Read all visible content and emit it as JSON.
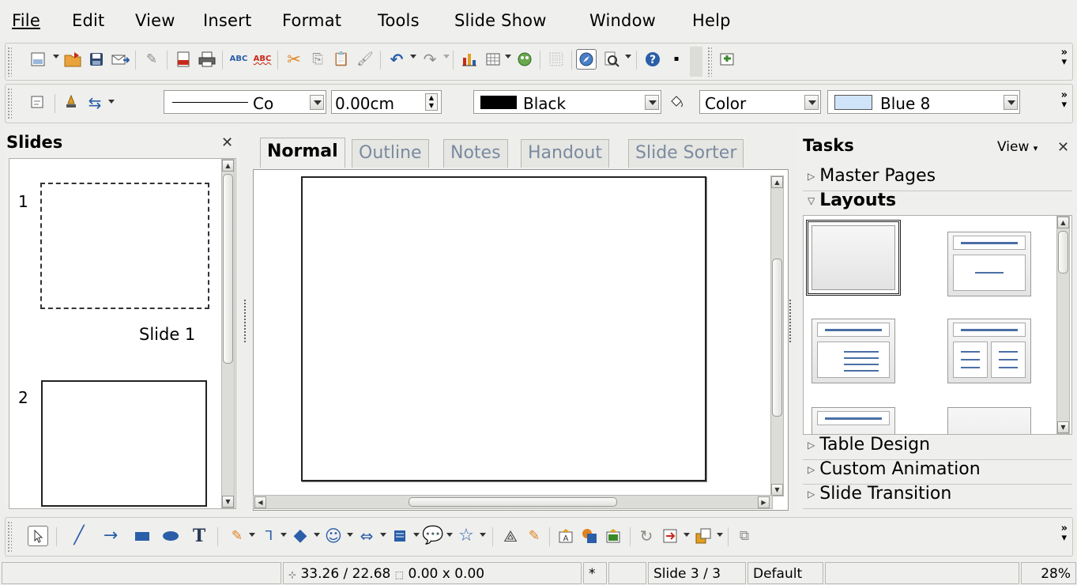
{
  "menu": [
    "File",
    "Edit",
    "View",
    "Insert",
    "Format",
    "Tools",
    "Slide Show",
    "Window",
    "Help"
  ],
  "line_toolbar": {
    "line_style_label": "Co",
    "line_width": "0.00cm",
    "line_color": "Black",
    "area_style": "Color",
    "area_fill": "Blue 8"
  },
  "colors": {
    "line_color_swatch": "#000000",
    "area_fill_swatch": "#cfe4f9",
    "accent": "#4a6fa5"
  },
  "slides_pane": {
    "title": "Slides",
    "slides": [
      {
        "number": "1",
        "label": "Slide 1"
      },
      {
        "number": "2",
        "label": ""
      }
    ]
  },
  "tabs": [
    "Normal",
    "Outline",
    "Notes",
    "Handout",
    "Slide Sorter"
  ],
  "tasks_pane": {
    "title": "Tasks",
    "view_label": "View",
    "sections": [
      "Master Pages",
      "Layouts",
      "Table Design",
      "Custom Animation",
      "Slide Transition"
    ]
  },
  "statusbar": {
    "position": "33.26 / 22.68",
    "size": "0.00 x 0.00",
    "modified": "*",
    "slide": "Slide 3 / 3",
    "master": "Default",
    "zoom": "28%"
  }
}
